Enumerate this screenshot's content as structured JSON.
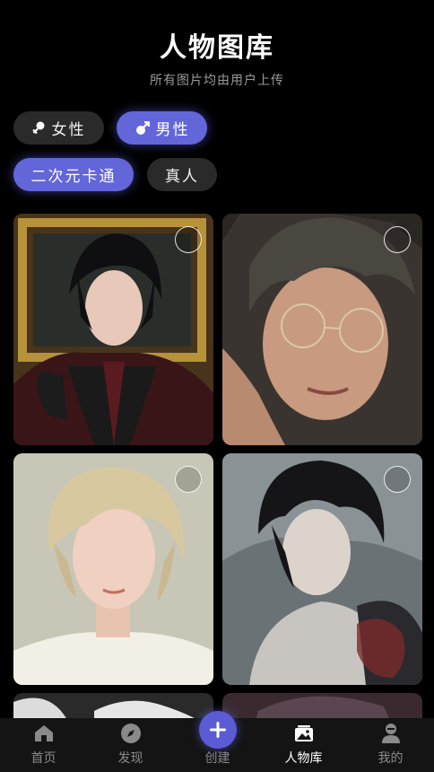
{
  "header": {
    "title": "人物图库",
    "subtitle": "所有图片均由用户上传"
  },
  "filters": {
    "gender": [
      {
        "label": "女性",
        "icon": "female-icon",
        "active": false
      },
      {
        "label": "男性",
        "icon": "male-icon",
        "active": true
      }
    ],
    "style": [
      {
        "label": "二次元卡通",
        "active": true
      },
      {
        "label": "真人",
        "active": false
      }
    ]
  },
  "gallery": {
    "items": [
      {
        "subject": "dark-haired-man-gloves-portrait",
        "selected": false
      },
      {
        "subject": "man-with-round-glasses-portrait",
        "selected": false
      },
      {
        "subject": "blonde-young-man-portrait",
        "selected": false
      },
      {
        "subject": "dark-haired-tattooed-man-portrait",
        "selected": false
      },
      {
        "subject": "silver-haired-portrait",
        "selected": false
      },
      {
        "subject": "dark-haired-portrait",
        "selected": false
      }
    ]
  },
  "tabbar": {
    "tabs": [
      {
        "label": "首页",
        "icon": "home-icon",
        "active": false
      },
      {
        "label": "发现",
        "icon": "compass-icon",
        "active": false
      },
      {
        "label": "创建",
        "icon": "plus-icon",
        "active": false
      },
      {
        "label": "人物库",
        "icon": "gallery-icon",
        "active": true
      },
      {
        "label": "我的",
        "icon": "user-icon",
        "active": false
      }
    ]
  },
  "colors": {
    "accent": "#6366d8",
    "background": "#000000",
    "chip_inactive": "#2a2a2a",
    "tabbar": "#141414"
  }
}
